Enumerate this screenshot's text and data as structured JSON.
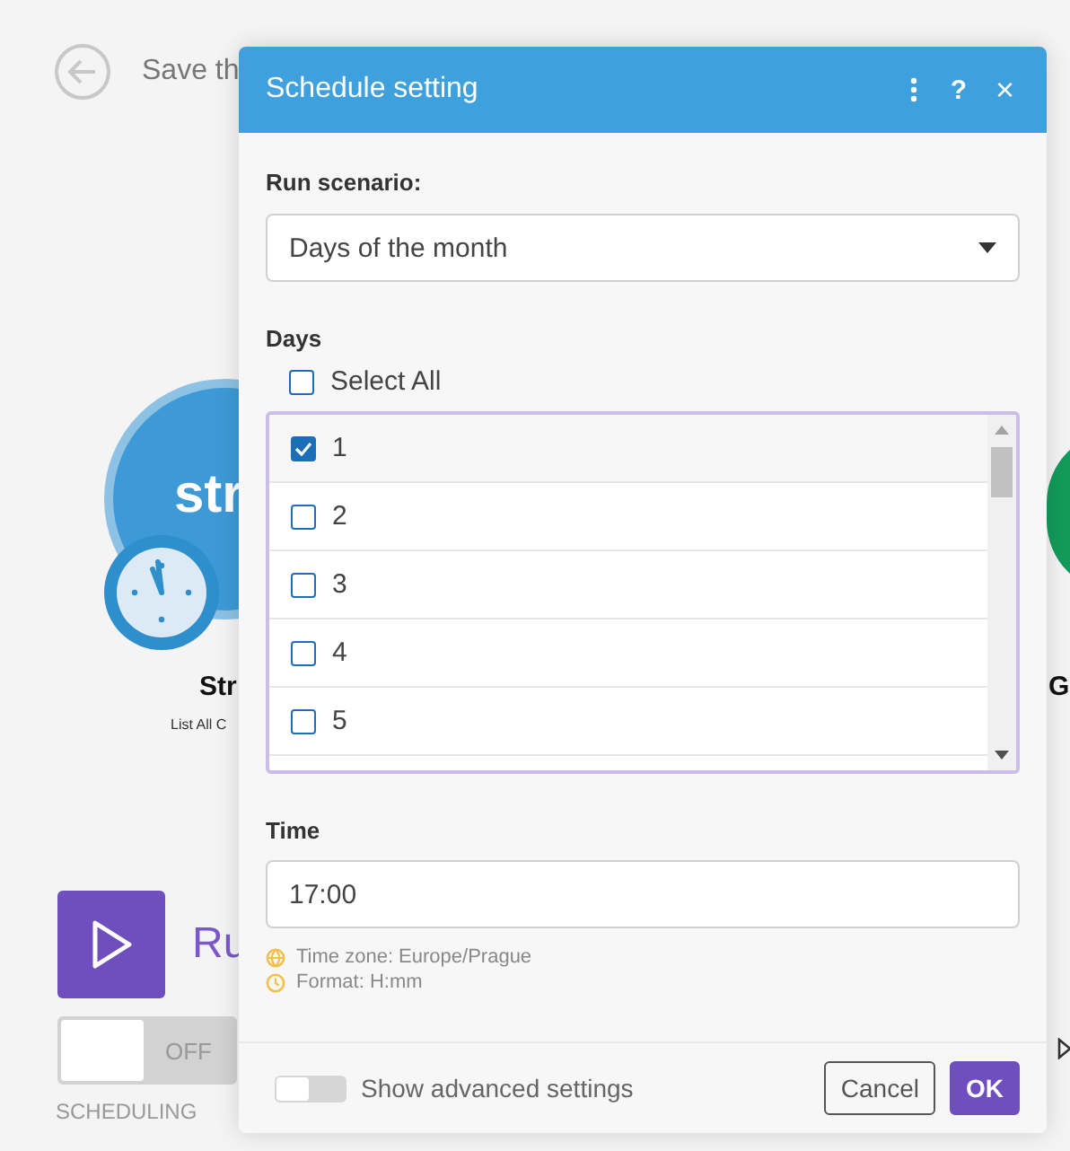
{
  "canvas": {
    "save_label": "Save th",
    "module": {
      "logo_text": "str",
      "name": "Str",
      "subtitle": "List All C"
    },
    "next_module": {
      "name": "G"
    },
    "run_label": "Ru",
    "scheduling": {
      "on": false,
      "state_label": "OFF",
      "label": "SCHEDULING"
    }
  },
  "dialog": {
    "title": "Schedule setting",
    "help_label": "?",
    "close_label": "×",
    "run_scenario": {
      "label": "Run scenario:",
      "value": "Days of the month"
    },
    "days": {
      "label": "Days",
      "select_all": {
        "label": "Select All",
        "checked": false
      },
      "items": [
        {
          "label": "1",
          "checked": true
        },
        {
          "label": "2",
          "checked": false
        },
        {
          "label": "3",
          "checked": false
        },
        {
          "label": "4",
          "checked": false
        },
        {
          "label": "5",
          "checked": false
        }
      ]
    },
    "time": {
      "label": "Time",
      "value": "17:00",
      "hints": [
        {
          "kind": "globe",
          "text": "Time zone: Europe/Prague"
        },
        {
          "kind": "clock",
          "text": "Format: H:mm"
        }
      ]
    },
    "advanced": {
      "on": false,
      "label": "Show advanced settings"
    },
    "buttons": [
      {
        "label": "Cancel",
        "kind": "secondary"
      },
      {
        "label": "OK",
        "kind": "primary"
      }
    ]
  }
}
